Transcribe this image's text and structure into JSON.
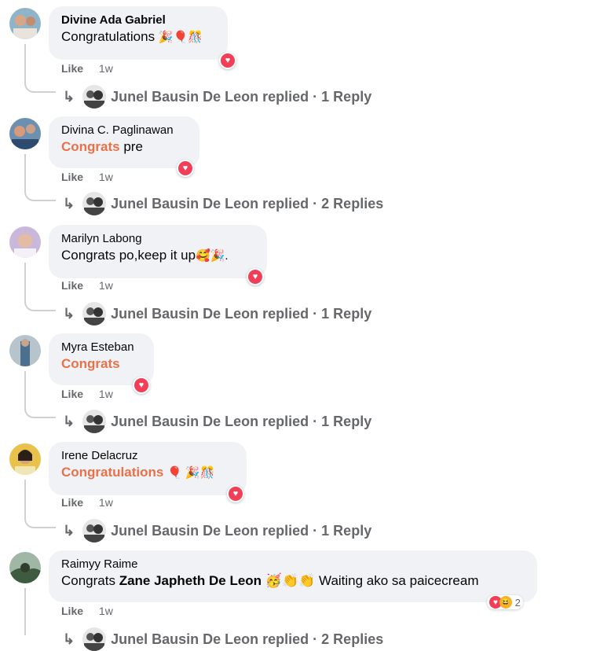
{
  "comments": [
    {
      "author": "Divine Ada Gabriel",
      "text_parts": [
        {
          "t": "Congratulations ",
          "style": "plain"
        }
      ],
      "emojis": "🎉🎈🎊",
      "like_label": "Like",
      "time": "1w",
      "replier": "Junel Bausin De Leon",
      "replied_label": "replied · 1 Reply"
    },
    {
      "author": "Divina C. Paglinawan",
      "text_parts": [
        {
          "t": "Congrats",
          "style": "hl"
        },
        {
          "t": " pre",
          "style": "plain"
        }
      ],
      "emojis": "",
      "like_label": "Like",
      "time": "1w",
      "replier": "Junel Bausin De Leon",
      "replied_label": "replied · 2 Replies"
    },
    {
      "author": "Marilyn Labong",
      "text_parts": [
        {
          "t": "Congrats po,keep it up",
          "style": "plain"
        }
      ],
      "emojis": "🥰🎉.",
      "like_label": "Like",
      "time": "1w",
      "replier": "Junel Bausin De Leon",
      "replied_label": "replied · 1 Reply"
    },
    {
      "author": "Myra Esteban",
      "text_parts": [
        {
          "t": "Congrats",
          "style": "hl"
        }
      ],
      "emojis": "",
      "like_label": "Like",
      "time": "1w",
      "replier": "Junel Bausin De Leon",
      "replied_label": "replied · 1 Reply"
    },
    {
      "author": "Irene Delacruz",
      "text_parts": [
        {
          "t": "Congratulations",
          "style": "hl"
        }
      ],
      "emojis": "🎈 🎉🎊",
      "like_label": "Like",
      "time": "1w",
      "replier": "Junel Bausin De Leon",
      "replied_label": "replied · 1 Reply"
    },
    {
      "author": "Raimyy Raime",
      "text_parts": [
        {
          "t": "Congrats ",
          "style": "plain"
        },
        {
          "t": "Zane Japheth De Leon",
          "style": "tag"
        },
        {
          "t": " 🥳👏👏 Waiting ako sa paicecream",
          "style": "plain"
        }
      ],
      "emojis": "",
      "like_label": "Like",
      "time": "1w",
      "reaction_count": "2",
      "replier": "Junel Bausin De Leon",
      "replied_label": "replied · 2 Replies"
    }
  ],
  "colors": {
    "highlight": "#e9714a",
    "heart": "#f33e58",
    "meta": "#65676b",
    "bubble": "#f0f2f5"
  },
  "icons": {
    "reply_arrow": "reply-arrow-icon",
    "reaction": "heart-reaction-icon"
  }
}
